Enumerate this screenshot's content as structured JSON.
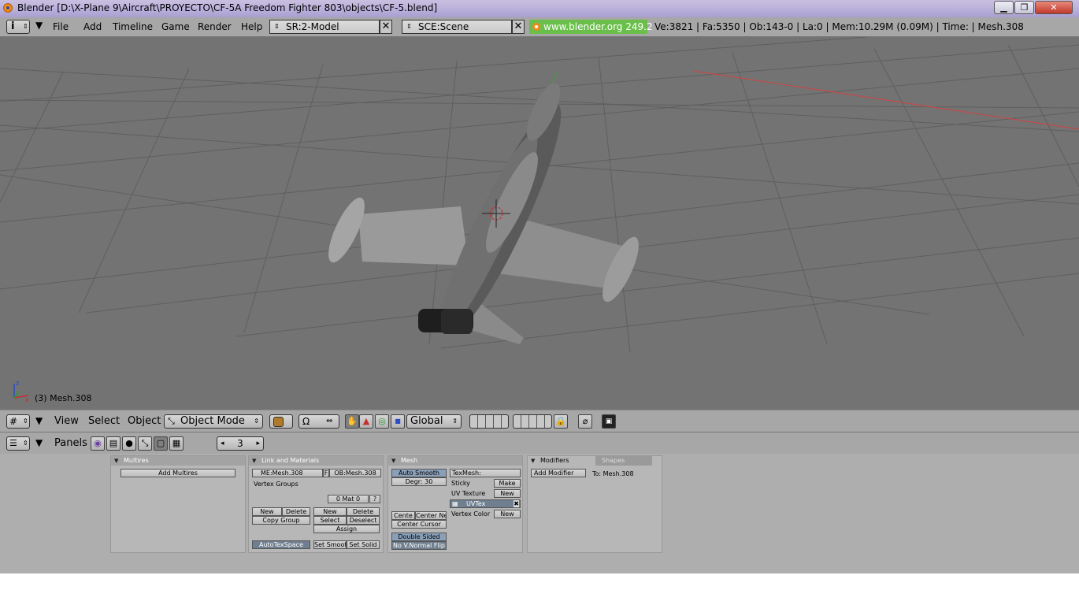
{
  "window": {
    "title": "Blender [D:\\X-Plane 9\\Aircraft\\PROYECTO\\CF-5A Freedom Fighter 803\\objects\\CF-5.blend]",
    "minimize_label": "▁",
    "maximize_label": "❐",
    "close_label": "✕"
  },
  "topbar": {
    "info_icon": "i",
    "menus": [
      "File",
      "Add",
      "Timeline",
      "Game",
      "Render",
      "Help"
    ],
    "screen_field": "SR:2-Model",
    "scene_field": "SCE:Scene",
    "close_x": "✕",
    "blender_link": "www.blender.org 249.2",
    "stats": "Ve:3821 | Fa:5350 | Ob:143-0 | La:0  | Mem:10.29M (0.09M)  | Time: | Mesh.308"
  },
  "viewport": {
    "object_label": "(3) Mesh.308",
    "axis_x": "x",
    "axis_z": "z"
  },
  "header3d": {
    "menus": [
      "View",
      "Select",
      "Object"
    ],
    "mode_select": "Object Mode",
    "orientation_select": "Global"
  },
  "buttons_header": {
    "panels_label": "Panels",
    "frame_value": "3"
  },
  "panels": {
    "multires": {
      "title": "Multires",
      "add_button": "Add Multires"
    },
    "link_materials": {
      "title": "Link and Materials",
      "me_field": "ME:Mesh.308",
      "f_label": "F",
      "ob_field": "OB:Mesh.308",
      "vertex_groups": "Vertex Groups",
      "mat_field": "0 Mat 0",
      "question": "?",
      "new_btn": "New",
      "delete_btn": "Delete",
      "copy_group": "Copy Group",
      "new2": "New",
      "delete2": "Delete",
      "select_btn": "Select",
      "deselect_btn": "Deselect",
      "assign_btn": "Assign",
      "autotexspace": "AutoTexSpace",
      "set_smooth": "Set Smoot",
      "set_solid": "Set Solid"
    },
    "mesh": {
      "title": "Mesh",
      "auto_smooth": "Auto Smooth",
      "degr": "Degr: 30",
      "texmesh": "TexMesh:",
      "sticky": "Sticky",
      "make": "Make",
      "uv_texture": "UV Texture",
      "uv_new": "New",
      "uvtex": "UVTex",
      "vertex_color": "Vertex Color",
      "vc_new": "New",
      "centre": "Cente",
      "center_new": "Center Ne",
      "center_cursor": "Center Cursor",
      "double_sided": "Double Sided",
      "no_vnormal_flip": "No V.Normal Flip"
    },
    "modifiers": {
      "tab_modifiers": "Modifiers",
      "tab_shapes": "Shapes",
      "add_modifier": "Add Modifier",
      "to_label": "To: Mesh.308"
    }
  },
  "colors": {
    "viewport_bg": "#737373",
    "header_bg": "#a7a7a7",
    "green_link": "#6abf4b",
    "grid": "#5d5d5d",
    "x_axis_line": "#c44a4a"
  }
}
